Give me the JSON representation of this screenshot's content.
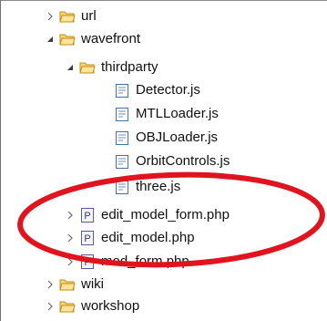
{
  "tree": {
    "items": [
      {
        "label": "url",
        "type": "folder",
        "state": "collapsed"
      },
      {
        "label": "wavefront",
        "type": "folder",
        "state": "expanded"
      },
      {
        "label": "thirdparty",
        "type": "folder",
        "state": "expanded"
      },
      {
        "label": "Detector.js",
        "type": "js-file"
      },
      {
        "label": "MTLLoader.js",
        "type": "js-file"
      },
      {
        "label": "OBJLoader.js",
        "type": "js-file"
      },
      {
        "label": "OrbitControls.js",
        "type": "js-file"
      },
      {
        "label": "three.js",
        "type": "js-file"
      },
      {
        "label": "edit_model_form.php",
        "type": "php-file",
        "state": "collapsed"
      },
      {
        "label": "edit_model.php",
        "type": "php-file",
        "state": "collapsed"
      },
      {
        "label": "mod_form.php",
        "type": "php-file",
        "state": "collapsed"
      },
      {
        "label": "wiki",
        "type": "folder",
        "state": "collapsed"
      },
      {
        "label": "workshop",
        "type": "folder",
        "state": "collapsed"
      }
    ]
  },
  "annotation": {
    "color": "#e0141e"
  },
  "colors": {
    "folder_fill": "#f7d774",
    "folder_stroke": "#c48b17",
    "js_file_stroke": "#4a6fa5",
    "php_file_fill": "#f4f4fb",
    "php_file_stroke": "#5b5b9a",
    "twisty": "#6a6a6a"
  }
}
